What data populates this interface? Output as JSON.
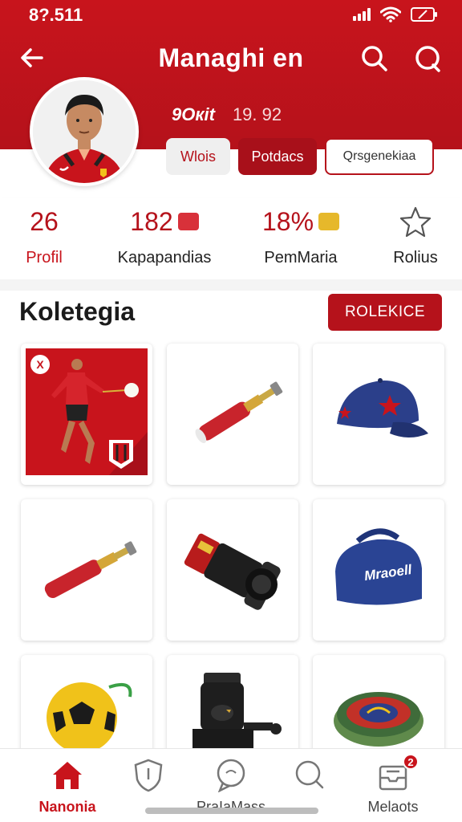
{
  "status": {
    "time": "8?.511"
  },
  "header": {
    "title": "Managhi en",
    "meta_a": "9Oкit",
    "meta_b": "19. 92"
  },
  "chips": [
    "Wlois",
    "Potdacs",
    "Qrsgenekiaa"
  ],
  "stats": [
    {
      "value": "26",
      "label": "Profil",
      "highlight": true
    },
    {
      "value": "182",
      "label": "Kapapandias",
      "highlight": false
    },
    {
      "value": "18%",
      "label": "PemMaria",
      "highlight": false
    },
    {
      "value": "",
      "label": "Rolius",
      "highlight": false
    }
  ],
  "section": {
    "title": "Koletegia",
    "button_label": "ROLEKICE"
  },
  "items": [
    {
      "name": "player-card",
      "close_label": "X"
    },
    {
      "name": "red-torch"
    },
    {
      "name": "blue-cap"
    },
    {
      "name": "red-torch-2"
    },
    {
      "name": "camera-lens"
    },
    {
      "name": "blue-bag",
      "label": "Mraoell"
    },
    {
      "name": "soccer-ball"
    },
    {
      "name": "black-device"
    },
    {
      "name": "round-badge"
    }
  ],
  "bottom_nav": [
    {
      "label": "Nanonia",
      "icon": "home-icon",
      "active": true
    },
    {
      "label": "",
      "icon": "shield-icon",
      "active": false
    },
    {
      "label": "PraIaMass",
      "icon": "chat-bubble-icon",
      "active": false
    },
    {
      "label": "",
      "icon": "message-icon",
      "active": false
    },
    {
      "label": "Melaots",
      "icon": "inbox-icon",
      "active": false,
      "badge": "2"
    }
  ],
  "colors": {
    "brand": "#c8141c",
    "brand_dark": "#a8101a",
    "navy": "#2b3f8a"
  }
}
